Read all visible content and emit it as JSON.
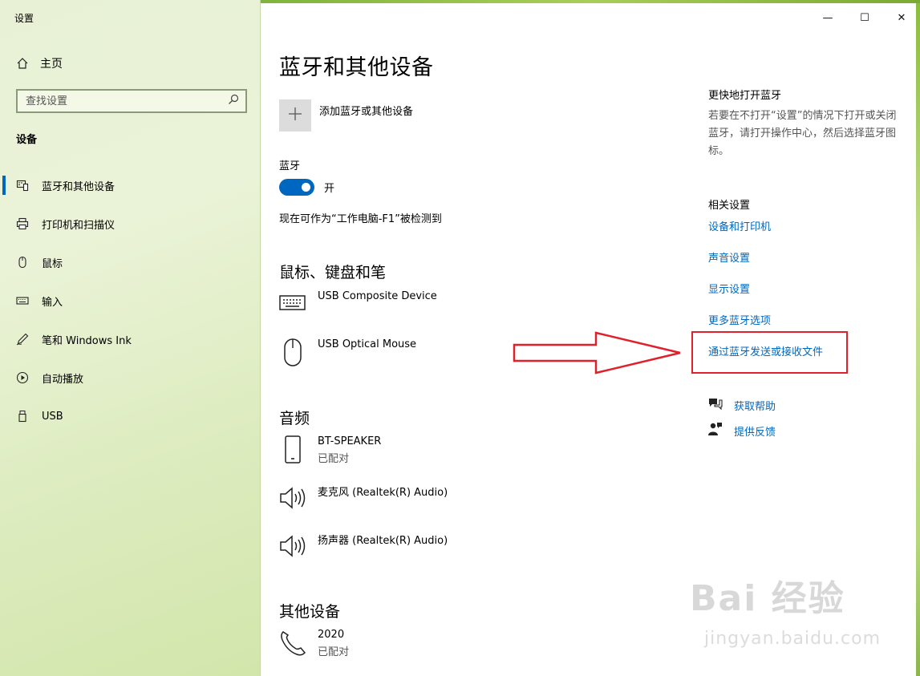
{
  "window": {
    "title": "设置",
    "controls": {
      "minimize": "—",
      "maximize": "☐",
      "close": "✕"
    }
  },
  "sidebar": {
    "home_label": "主页",
    "search_placeholder": "查找设置",
    "section_label": "设备",
    "items": [
      {
        "label": "蓝牙和其他设备",
        "icon": "bluetooth-devices-icon",
        "active": true
      },
      {
        "label": "打印机和扫描仪",
        "icon": "printer-icon",
        "active": false
      },
      {
        "label": "鼠标",
        "icon": "mouse-icon",
        "active": false
      },
      {
        "label": "输入",
        "icon": "keyboard-icon",
        "active": false
      },
      {
        "label": "笔和 Windows Ink",
        "icon": "pen-icon",
        "active": false
      },
      {
        "label": "自动播放",
        "icon": "autoplay-icon",
        "active": false
      },
      {
        "label": "USB",
        "icon": "usb-icon",
        "active": false
      }
    ]
  },
  "main": {
    "page_title": "蓝牙和其他设备",
    "add_device_label": "添加蓝牙或其他设备",
    "bluetooth": {
      "label": "蓝牙",
      "state_label": "开",
      "discoverable_text": "现在可作为“工作电脑-F1”被检测到"
    },
    "groups": [
      {
        "title": "鼠标、键盘和笔",
        "devices": [
          {
            "name": "USB Composite Device",
            "status": "",
            "icon": "keyboard-icon"
          },
          {
            "name": "USB Optical Mouse",
            "status": "",
            "icon": "mouse-icon"
          }
        ]
      },
      {
        "title": "音频",
        "devices": [
          {
            "name": "BT-SPEAKER",
            "status": "已配对",
            "icon": "phone-device-icon"
          },
          {
            "name": "麦克风 (Realtek(R) Audio)",
            "status": "",
            "icon": "speaker-icon"
          },
          {
            "name": "扬声器 (Realtek(R) Audio)",
            "status": "",
            "icon": "speaker-icon"
          }
        ]
      },
      {
        "title": "其他设备",
        "devices": [
          {
            "name": "2020",
            "status": "已配对",
            "icon": "phone-handset-icon"
          }
        ]
      }
    ]
  },
  "right_panel": {
    "quick_title": "更快地打开蓝牙",
    "quick_desc": "若要在不打开“设置”的情况下打开或关闭蓝牙，请打开操作中心，然后选择蓝牙图标。",
    "related_title": "相关设置",
    "links": [
      "设备和打印机",
      "声音设置",
      "显示设置",
      "更多蓝牙选项",
      "通过蓝牙发送或接收文件"
    ],
    "help": [
      "获取帮助",
      "提供反馈"
    ]
  },
  "watermark": {
    "brand": "Bai 经验",
    "url": "jingyan.baidu.com"
  },
  "colors": {
    "accent": "#0067c0",
    "annotation": "#e0202a"
  }
}
